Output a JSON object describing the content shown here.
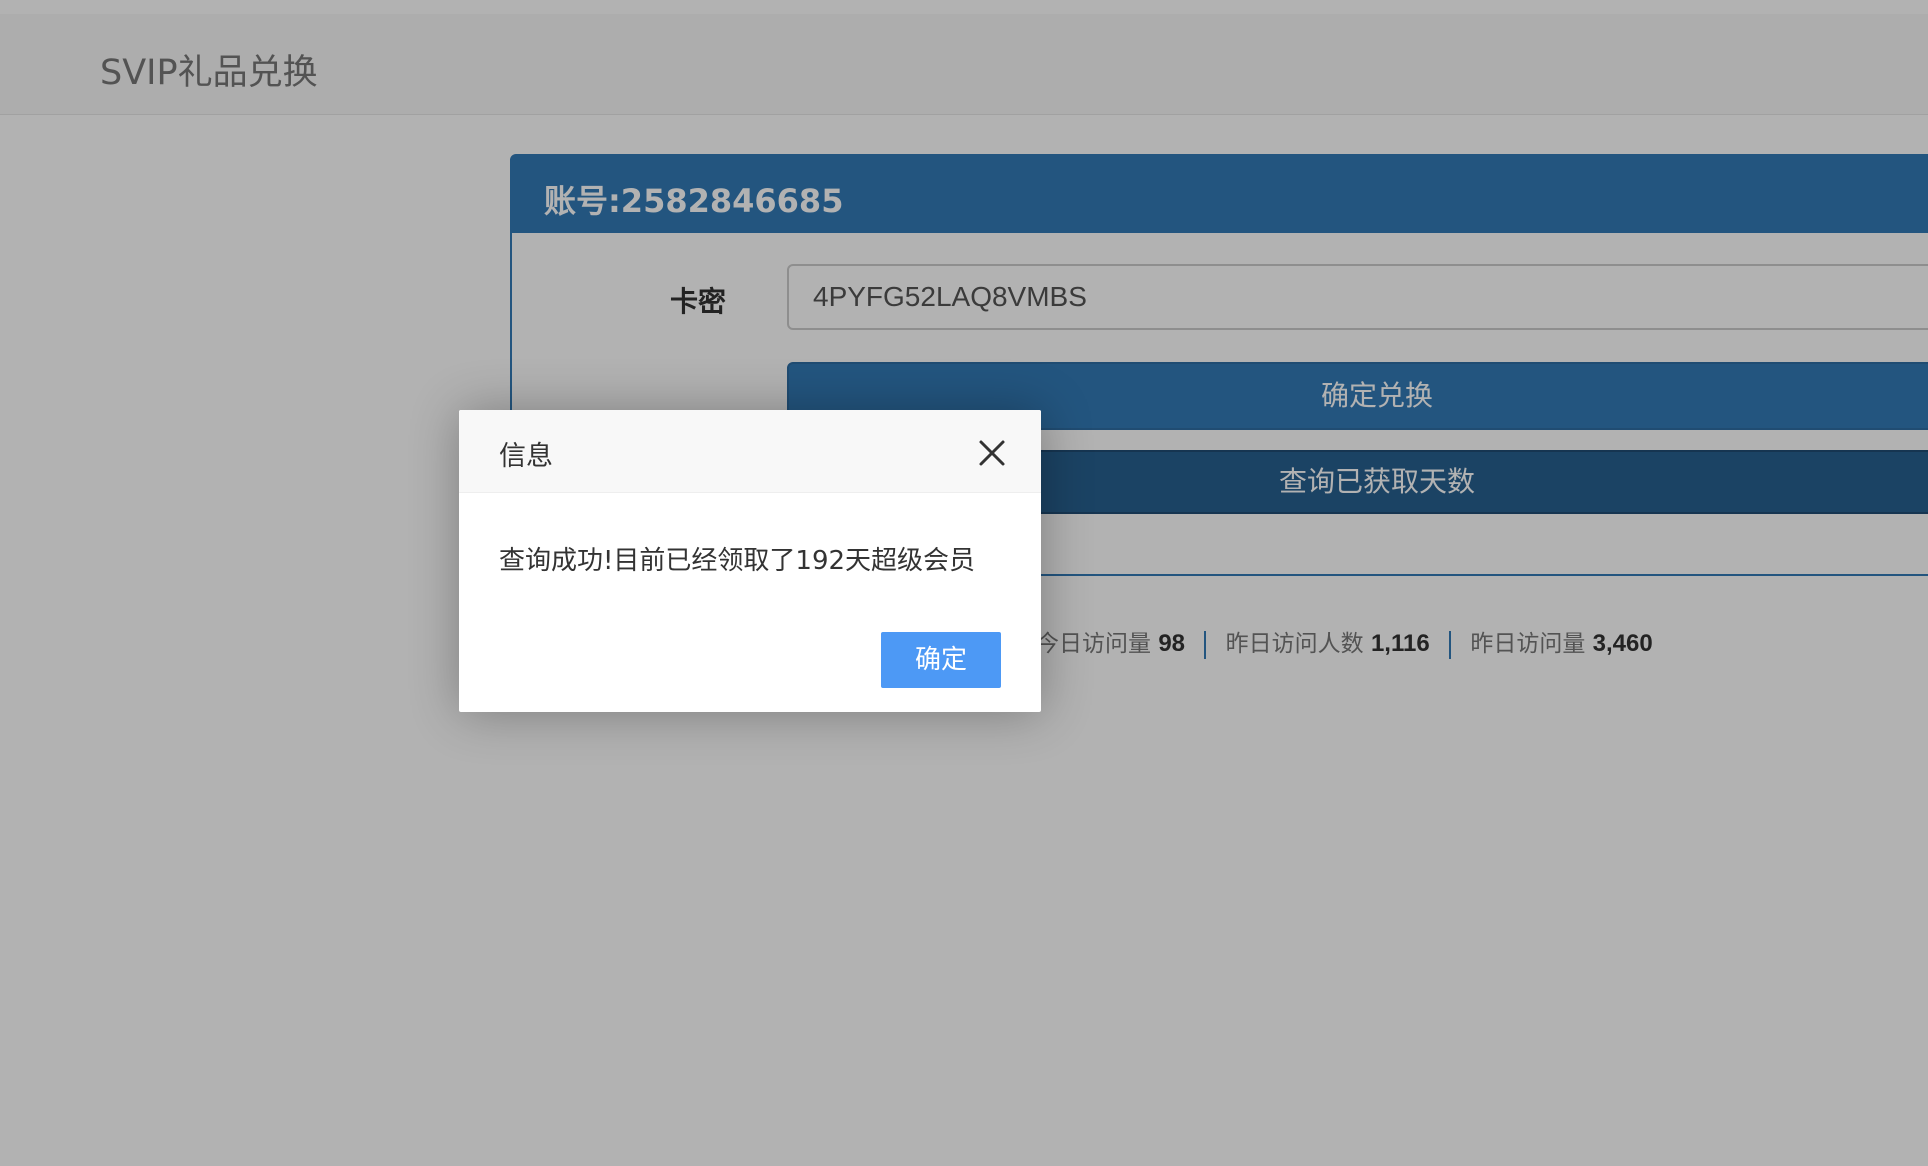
{
  "navbar": {
    "brand": "SVIP礼品兑换"
  },
  "panel": {
    "title": "账号:2582846685",
    "card_label": "卡密",
    "card_value": "4PYFG52LAQ8VMBS",
    "redeem_button": "确定兑换",
    "query_button": "查询已获取天数"
  },
  "stats": {
    "today_visits_label": "今日访问量",
    "today_visits": "98",
    "yesterday_visitors_label": "昨日访问人数",
    "yesterday_visitors": "1,116",
    "yesterday_visits_label": "昨日访问量",
    "yesterday_visits": "3,460"
  },
  "dialog": {
    "title": "信息",
    "message": "查询成功!目前已经领取了192天超级会员",
    "ok_button": "确定",
    "close_icon": "close-icon"
  },
  "colors": {
    "primary": "#337ab7",
    "dialog_button": "#4d99f5",
    "overlay": "rgba(0,0,0,0.3)"
  }
}
